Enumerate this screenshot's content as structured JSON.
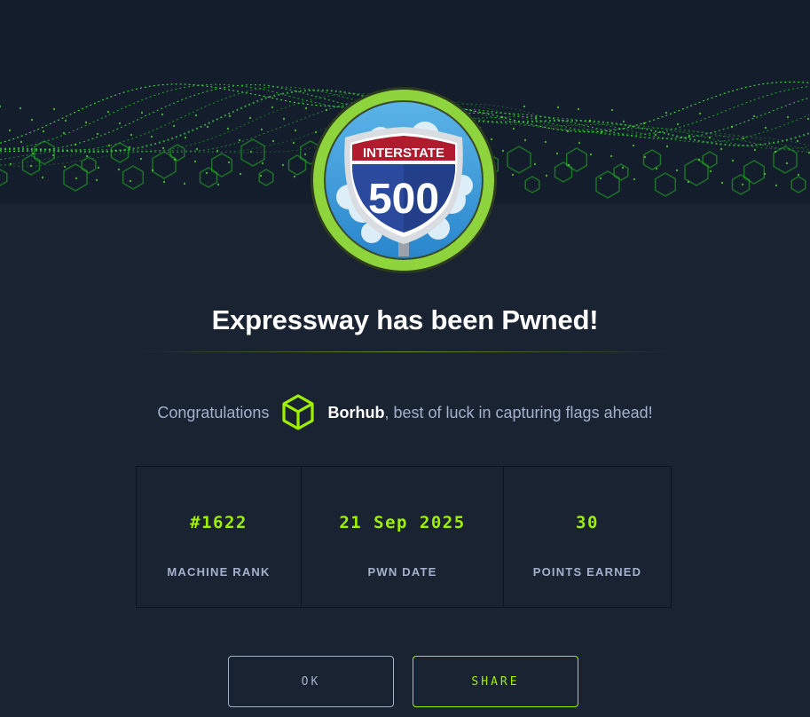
{
  "badge": {
    "sign_header": "INTERSTATE",
    "sign_number": "500"
  },
  "modal": {
    "title": "Expressway has been Pwned!",
    "congrats_prefix": "Congratulations",
    "username": "Borhub",
    "congrats_suffix": ", best of luck in capturing flags ahead!"
  },
  "stats": [
    {
      "value": "#1622",
      "label": "MACHINE RANK"
    },
    {
      "value": "21 Sep 2025",
      "label": "PWN DATE"
    },
    {
      "value": "30",
      "label": "POINTS EARNED"
    }
  ],
  "buttons": {
    "ok": "OK",
    "share": "SHARE"
  },
  "colors": {
    "background": "#1a2332",
    "accent": "#9fef00",
    "muted_text": "#a4b1cd",
    "badge_ring": "#8ed43c",
    "sign_red": "#b01c2e",
    "sign_blue": "#2b4a9e"
  },
  "icons": {
    "user_avatar": "cube-icon",
    "banner": "green-network-wave"
  }
}
